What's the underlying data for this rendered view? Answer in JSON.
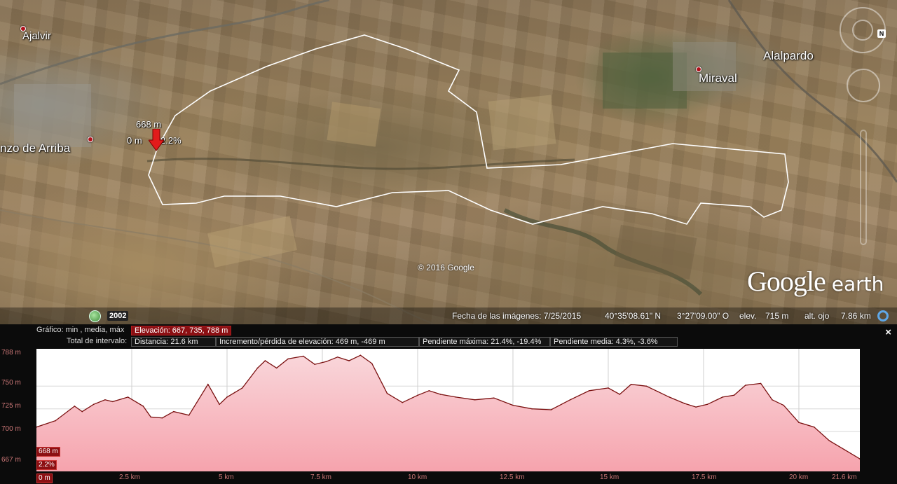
{
  "map": {
    "places": [
      {
        "name": "Ajalvir"
      },
      {
        "name": "nzo de Arriba"
      },
      {
        "name": "Miraval"
      },
      {
        "name": "Alalpardo"
      }
    ],
    "marker": {
      "elevation": "668 m",
      "distance": "0 m",
      "slope": "2.2%"
    },
    "copyright": "© 2016 Google",
    "logo": {
      "google": "Google",
      "earth": "earth"
    },
    "nav_n": "N",
    "history_year": "2002"
  },
  "status": {
    "date": "Fecha de las imágenes: 7/25/2015",
    "lat": "40°35'08.61\" N",
    "lon": "3°27'09.00\" O",
    "elev_label": "elev.",
    "elev_value": "715 m",
    "eye_label": "alt. ojo",
    "eye_value": "7.86 km"
  },
  "profile": {
    "row1_label": "Gráfico: min , media, máx",
    "row1_value": "Elevación: 667, 735, 788 m",
    "row2_label": "Total de intervalo:",
    "distance": "Distancia: 21.6 km",
    "gain_loss": "Incremento/pérdida de elevación: 469 m, -469 m",
    "max_slope": "Pendiente máxima: 21.4%, -19.4%",
    "avg_slope": "Pendiente media: 4.3%, -3.6%",
    "cursor_elev": "668 m",
    "cursor_slope": "2.2%",
    "cursor_dist": "0 m",
    "close": "×",
    "y_ticks": [
      "788 m",
      "750 m",
      "725 m",
      "700 m",
      "667 m"
    ],
    "x_ticks": [
      "2.5 km",
      "5 km",
      "7.5 km",
      "10 km",
      "12.5 km",
      "15 km",
      "17.5 km",
      "20 km",
      "21.6 km"
    ]
  },
  "chart_data": {
    "type": "area",
    "xlabel": "",
    "ylabel": "",
    "xlim": [
      0,
      21.6
    ],
    "ylim": [
      667,
      788
    ],
    "colors": {
      "fill": "#f6a3ad",
      "line": "#7a1010"
    },
    "x": [
      0,
      0.5,
      1.0,
      1.2,
      1.5,
      1.8,
      2.0,
      2.4,
      2.8,
      3.0,
      3.3,
      3.6,
      4.0,
      4.5,
      4.8,
      5.0,
      5.2,
      5.4,
      5.8,
      6.0,
      6.3,
      6.6,
      7.0,
      7.3,
      7.6,
      7.9,
      8.2,
      8.5,
      8.8,
      9.2,
      9.6,
      10.0,
      10.3,
      10.6,
      11.0,
      11.5,
      12.0,
      12.5,
      13.0,
      13.5,
      14.0,
      14.5,
      15.0,
      15.3,
      15.6,
      16.0,
      16.3,
      16.6,
      17.0,
      17.3,
      17.6,
      18.0,
      18.3,
      18.6,
      19.0,
      19.3,
      19.6,
      20.0,
      20.4,
      20.8,
      21.2,
      21.6
    ],
    "y": [
      705,
      712,
      728,
      722,
      730,
      735,
      733,
      738,
      728,
      716,
      715,
      722,
      718,
      752,
      730,
      738,
      743,
      748,
      770,
      778,
      770,
      780,
      783,
      774,
      777,
      782,
      778,
      784,
      775,
      742,
      732,
      740,
      745,
      741,
      738,
      735,
      737,
      729,
      725,
      724,
      735,
      745,
      748,
      741,
      752,
      750,
      744,
      738,
      731,
      727,
      730,
      738,
      740,
      751,
      753,
      735,
      729,
      710,
      705,
      690,
      680,
      670
    ]
  }
}
